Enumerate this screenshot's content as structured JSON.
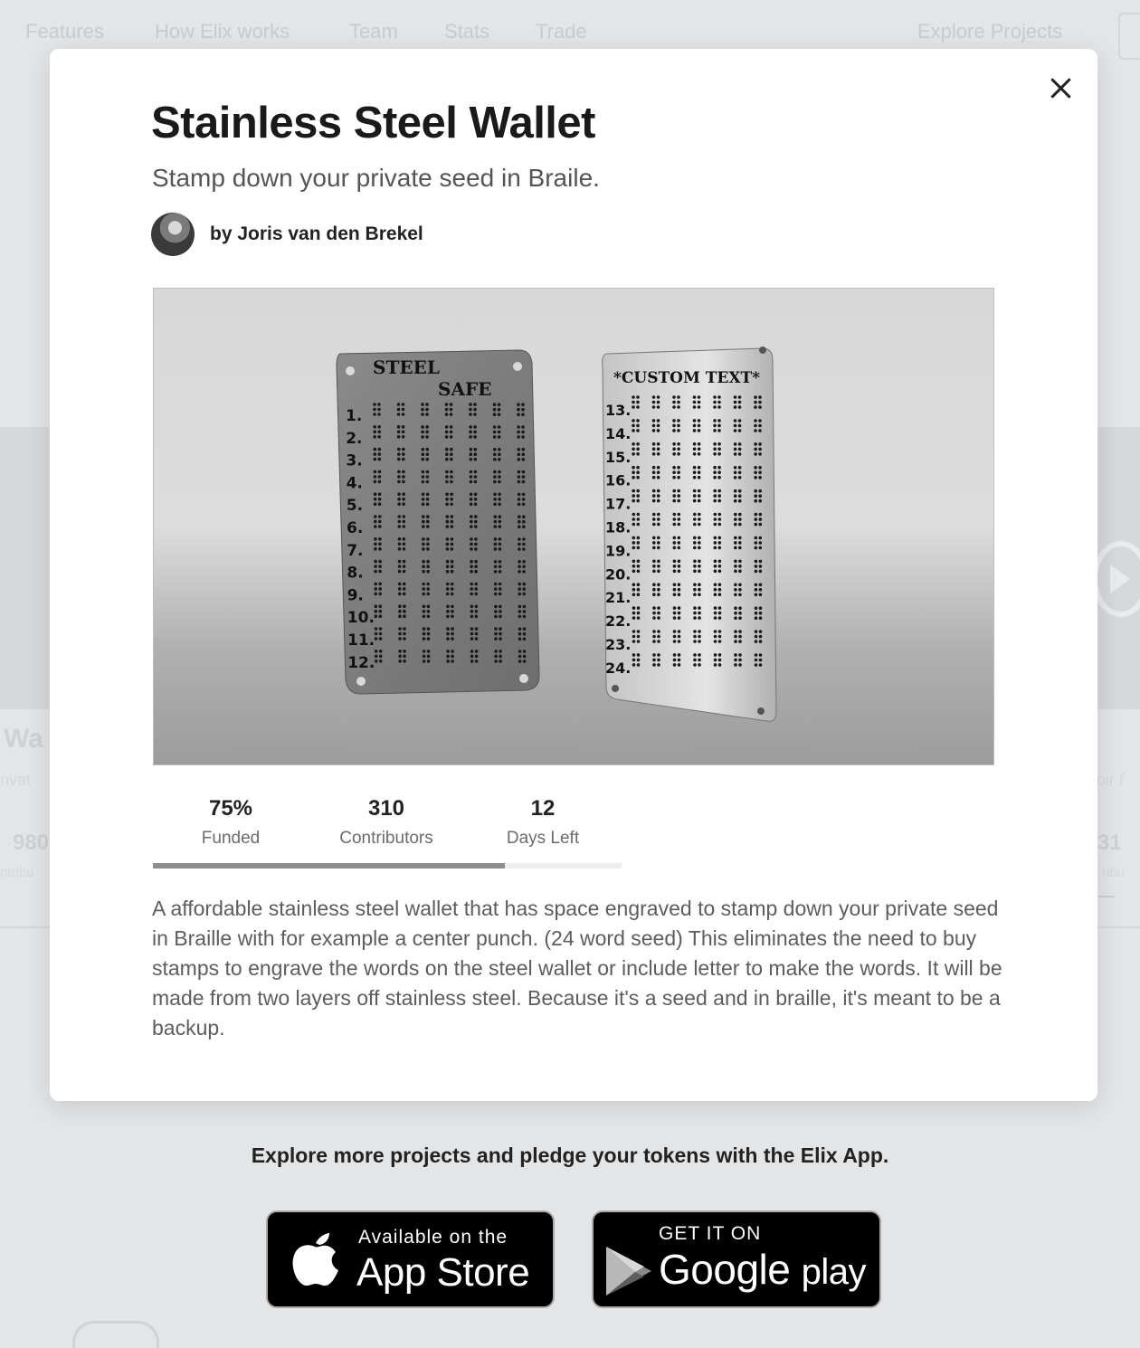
{
  "background_nav": {
    "items": [
      "Features",
      "How Elix works",
      "Team",
      "Stats",
      "Trade"
    ],
    "explore": "Explore Projects"
  },
  "background_cards": {
    "left_title": "Wa",
    "left_sub": "rivat",
    "left_number": "980",
    "left_label": "ntribu",
    "right_sub": "oir f",
    "right_number": "31",
    "right_label": "ribu"
  },
  "modal": {
    "title": "Stainless Steel Wallet",
    "subtitle": "Stamp down your private seed in Braile.",
    "author": "by Joris van den Brekel",
    "image": {
      "left_plate_line1": "STEEL",
      "left_plate_line2": "SAFE",
      "right_plate_title": "*CUSTOM TEXT*",
      "left_numbers": [
        "1.",
        "2.",
        "3.",
        "4.",
        "5.",
        "6.",
        "7.",
        "8.",
        "9.",
        "10.",
        "11.",
        "12."
      ],
      "right_numbers": [
        "13.",
        "14.",
        "15.",
        "16.",
        "17.",
        "18.",
        "19.",
        "20.",
        "21.",
        "22.",
        "23.",
        "24."
      ]
    },
    "stats": [
      {
        "value": "75%",
        "label": "Funded"
      },
      {
        "value": "310",
        "label": "Contributors"
      },
      {
        "value": "12",
        "label": "Days Left"
      }
    ],
    "funded_fraction": 0.75,
    "description": "A affordable stainless steel wallet that has space engraved to stamp down your private seed in Braille with for example a center punch. (24 word seed) This eliminates the need to buy stamps to engrave the words on the steel wallet or include letter to make the words. It will be made from two layers off stainless steel. Because it's a seed and in braille, it's meant to be a backup."
  },
  "footer": {
    "explore_text": "Explore more projects and pledge your tokens with the Elix App.",
    "app_store": {
      "small": "Available on the",
      "big": "App Store"
    },
    "google_play": {
      "small": "GET IT ON",
      "big_1": "Google",
      "big_2": "play"
    }
  }
}
